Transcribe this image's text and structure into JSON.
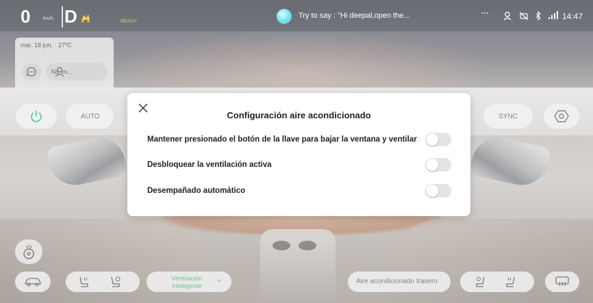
{
  "status_bar": {
    "speed": "0",
    "speed_unit": "km/h",
    "gear": "D",
    "drive_state": "READY",
    "voice_hint": "Try to say : \"Hi deepal,open the...",
    "more": "···",
    "time": "14:47",
    "icons": [
      "drive-mode-icon",
      "voice-assistant-icon",
      "user-face-icon",
      "no-camera-icon",
      "bluetooth-icon",
      "signal-icon"
    ]
  },
  "weather_card": {
    "date_temp": "mar. 18 jun. · 27ºC",
    "user_label": "No ini...",
    "icons": [
      "chat-icon",
      "user-icon"
    ]
  },
  "climate": {
    "power_icon": "power-icon",
    "auto_label": "AUTO",
    "sync_label": "SYNC",
    "settings_icon": "climate-settings-icon",
    "heated_wheel_icon": "heated-steering-wheel-icon"
  },
  "bottom_bar": {
    "car_icon": "car-icon",
    "seat_heat_icon": "seat-heat-icon",
    "seat_vent_icon": "seat-ventilation-icon",
    "smart_vent_label": "Ventilación inteligente",
    "rear_ac_label": "Aire acondicionado trasero",
    "right_seat_vent_icon": "right-seat-ventilation-icon",
    "right_seat_heat_icon": "right-seat-heat-icon",
    "rear_defrost_icon": "rear-defrost-icon"
  },
  "dialog": {
    "title": "Configuración aire acondicionado",
    "options": [
      {
        "label": "Mantener presionado el botón de la llave para bajar la ventana y ventilar",
        "enabled": false
      },
      {
        "label": "Desbloquear la ventilación activa",
        "enabled": false
      },
      {
        "label": "Desempañado automático",
        "enabled": false
      }
    ]
  },
  "colors": {
    "accent_green": "#2bb673",
    "ready_green": "#7ddc3c",
    "mode_yellow": "#f5c200",
    "voice_cyan": "#3ed6e6"
  }
}
